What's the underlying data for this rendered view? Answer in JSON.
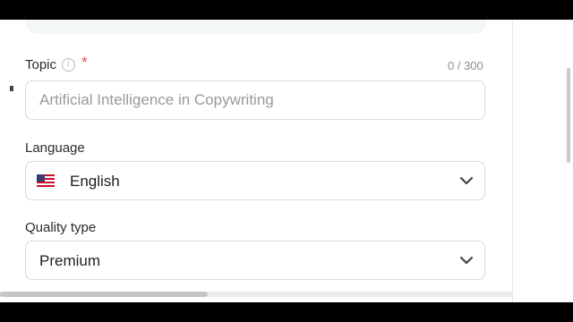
{
  "topic": {
    "label": "Topic",
    "required_mark": "*",
    "counter": "0 / 300",
    "placeholder": "Artificial Intelligence in Copywriting",
    "value": ""
  },
  "language": {
    "label": "Language",
    "selected": "English",
    "flag": "us-flag-icon"
  },
  "quality": {
    "label": "Quality type",
    "selected": "Premium"
  },
  "icons": {
    "info": "info-icon",
    "chevron": "chevron-down-icon"
  },
  "colors": {
    "required": "#e24b4b",
    "border": "#d9d9d9",
    "text": "#2b2b2b",
    "muted": "#8e8e8e"
  }
}
